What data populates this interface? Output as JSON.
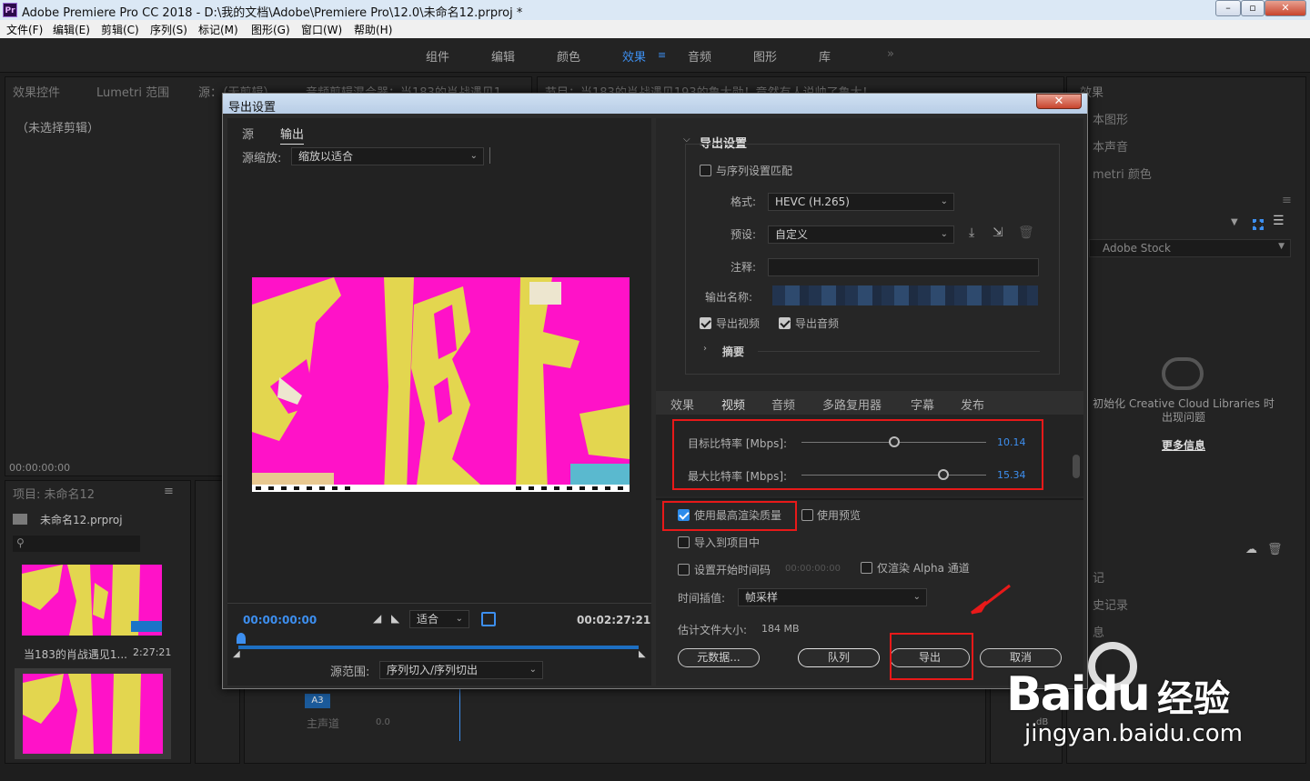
{
  "window": {
    "app_icon": "Pr",
    "title": "Adobe Premiere Pro CC 2018 - D:\\我的文档\\Adobe\\Premiere Pro\\12.0\\未命名12.prproj *"
  },
  "menu": [
    "文件(F)",
    "编辑(E)",
    "剪辑(C)",
    "序列(S)",
    "标记(M)",
    "图形(G)",
    "窗口(W)",
    "帮助(H)"
  ],
  "workspaces": {
    "items": [
      "组件",
      "编辑",
      "颜色",
      "效果",
      "音频",
      "图形",
      "库"
    ],
    "active": "效果",
    "more": "»"
  },
  "left_panel": {
    "tabs": [
      "效果控件",
      "Lumetri 范围",
      "源：（无剪辑）",
      "音频剪辑混合器：当183的肖战遇见1"
    ],
    "no_clip": "（未选择剪辑）",
    "timecode": "00:00:00:00"
  },
  "program_tab": "节目：当183的肖战遇见193的鲁大勋！竟然有人说帅了鲁大！",
  "project_panel": {
    "title": "项目: 未命名12",
    "file": "未命名12.prproj",
    "clip_name": "当183的肖战遇见1...",
    "clip_duration": "2:27:21"
  },
  "right_panel": {
    "title": "效果",
    "items": [
      "本图形",
      "本声音",
      "metri 颜色"
    ],
    "stock": "Adobe Stock",
    "cc_message": "初始化 Creative Cloud Libraries 时出现问题",
    "more_info": "更多信息",
    "lower_items": [
      "记",
      "史记录",
      "息"
    ]
  },
  "timeline": {
    "track": "A3",
    "master": "主声道",
    "master_value": "0.0",
    "db": "dB"
  },
  "dialog": {
    "title": "导出设置",
    "close": "✕",
    "left": {
      "tabs": [
        "源",
        "输出"
      ],
      "active_tab": "输出",
      "scale_label": "源缩放:",
      "scale_value": "缩放以适合",
      "timecode_start": "00:00:00:00",
      "fit": "适合",
      "timecode_end": "00:02:27:21",
      "range_label": "源范围:",
      "range_value": "序列切入/序列切出"
    },
    "export_settings": {
      "header": "导出设置",
      "match_sequence": "与序列设置匹配",
      "format_label": "格式:",
      "format_value": "HEVC (H.265)",
      "preset_label": "预设:",
      "preset_value": "自定义",
      "comments_label": "注释:",
      "comments_value": "",
      "output_name_label": "输出名称:",
      "export_video": "导出视频",
      "export_audio": "导出音频",
      "summary": "摘要"
    },
    "tabs": [
      "效果",
      "视频",
      "音频",
      "多路复用器",
      "字幕",
      "发布"
    ],
    "active_tab": "视频",
    "bitrate": {
      "target_label": "目标比特率 [Mbps]:",
      "target_value": "10.14",
      "max_label": "最大比特率 [Mbps]:",
      "max_value": "15.34",
      "range_max": 20,
      "target_pos": 0.5,
      "max_pos": 0.77
    },
    "options": {
      "max_render": "使用最高渲染质量",
      "use_preview": "使用预览",
      "import_project": "导入到项目中",
      "set_timecode": "设置开始时间码",
      "timecode_value": "00:00:00:00",
      "alpha_only": "仅渲染 Alpha 通道",
      "interp_label": "时间插值:",
      "interp_value": "帧采样",
      "filesize_label": "估计文件大小:",
      "filesize_value": "184 MB"
    },
    "buttons": {
      "metadata": "元数据...",
      "queue": "队列",
      "export": "导出",
      "cancel": "取消"
    }
  },
  "watermark": {
    "brand": "Baidu",
    "cn": "经验",
    "url": "jingyan.baidu.com"
  },
  "colors": {
    "accent": "#2d8ceb",
    "highlight": "#e81919",
    "preview_magenta": "#ff12c8",
    "preview_yellow": "#e3d64f"
  }
}
